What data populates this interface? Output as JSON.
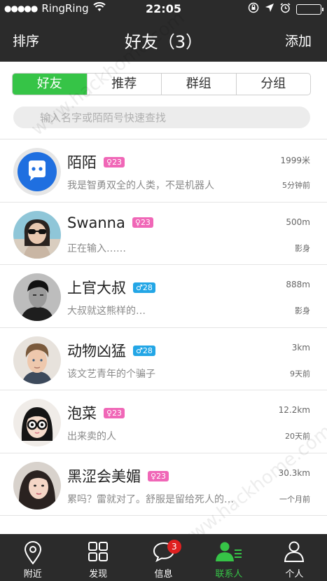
{
  "status_bar": {
    "carrier": "RingRing",
    "time": "22:05"
  },
  "navbar": {
    "sort_label": "排序",
    "title": "好友（3）",
    "add_label": "添加"
  },
  "segments": [
    {
      "label": "好友",
      "active": true
    },
    {
      "label": "推荐",
      "active": false
    },
    {
      "label": "群组",
      "active": false
    },
    {
      "label": "分组",
      "active": false
    }
  ],
  "search": {
    "placeholder": "输入名字或陌陌号快速查找"
  },
  "contacts": [
    {
      "name": "陌陌",
      "gender": "female",
      "age": "23",
      "status": "我是智勇双全的人类，不是机器人",
      "distance": "1999米",
      "time": "5分钟前",
      "avatar": "momo-logo"
    },
    {
      "name": "Swanna",
      "gender": "female",
      "age": "23",
      "status": "正在输入……",
      "distance": "500m",
      "time": "影身",
      "avatar": "sunglasses-girl"
    },
    {
      "name": "上官大叔",
      "gender": "male",
      "age": "28",
      "status": "大叔就这熊样的…",
      "distance": "888m",
      "time": "影身",
      "avatar": "bw-man"
    },
    {
      "name": "动物凶猛",
      "gender": "male",
      "age": "28",
      "status": "该文艺青年的个骗子",
      "distance": "3km",
      "time": "9天前",
      "avatar": "young-man"
    },
    {
      "name": "泡菜",
      "gender": "female",
      "age": "23",
      "status": "出来卖的人",
      "distance": "12.2km",
      "time": "20天前",
      "avatar": "glasses-girl"
    },
    {
      "name": "黑涩会美媚",
      "gender": "female",
      "age": "23",
      "status": "累吗？雷就对了。舒服是留给死人的…",
      "distance": "30.3km",
      "time": "一个月前",
      "avatar": "long-hair-girl"
    }
  ],
  "tabbar": [
    {
      "label": "附近",
      "icon": "location-pin-icon",
      "active": false
    },
    {
      "label": "发现",
      "icon": "grid-icon",
      "active": false
    },
    {
      "label": "信息",
      "icon": "chat-bubble-icon",
      "active": false,
      "badge": "3"
    },
    {
      "label": "联系人",
      "icon": "contacts-icon",
      "active": true
    },
    {
      "label": "个人",
      "icon": "person-icon",
      "active": false
    }
  ],
  "watermark": "www.hackhome.com",
  "colors": {
    "accent": "#36c447",
    "bar": "#2b2b2b",
    "female_badge": "#f067b7",
    "male_badge": "#23a6e6",
    "notify": "#e02020"
  }
}
